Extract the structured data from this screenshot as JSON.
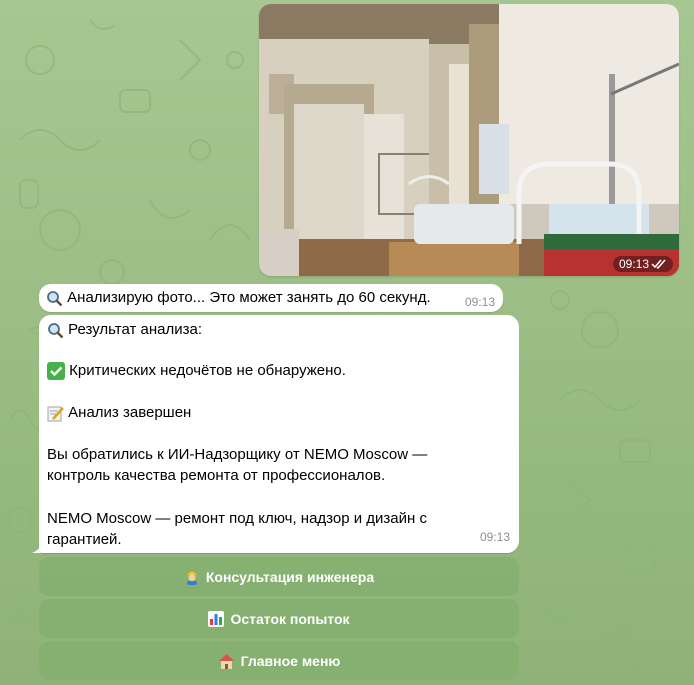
{
  "photo_message": {
    "time": "09:13",
    "status_icon": "double-check-icon"
  },
  "status_message": {
    "icon": "magnifier-icon",
    "text": "Анализирую фото... Это может занять до 60 секунд.",
    "time": "09:13"
  },
  "result_message": {
    "heading": "Результат анализа:",
    "finding": "Критических недочётов не обнаружено.",
    "done": "Анализ завершен",
    "intro_line1": "Вы обратились к ИИ-Надзорщику от NEMO Moscow —",
    "intro_line2": "контроль качества ремонта от профессионалов.",
    "promo_line1": "NEMO Moscow — ремонт под ключ, надзор и дизайн с",
    "promo_line2": "гарантией.",
    "time": "09:13"
  },
  "keyboard": [
    {
      "icon": "worker-icon",
      "label": "Консультация инженера"
    },
    {
      "icon": "bar-chart-icon",
      "label": "Остаток попыток"
    },
    {
      "icon": "house-icon",
      "label": "Главное меню"
    }
  ],
  "colors": {
    "chat_bg": "#9fc089",
    "bubble": "#ffffff",
    "time_gray": "#8f8f8f",
    "button_bg": "#82af6e"
  }
}
